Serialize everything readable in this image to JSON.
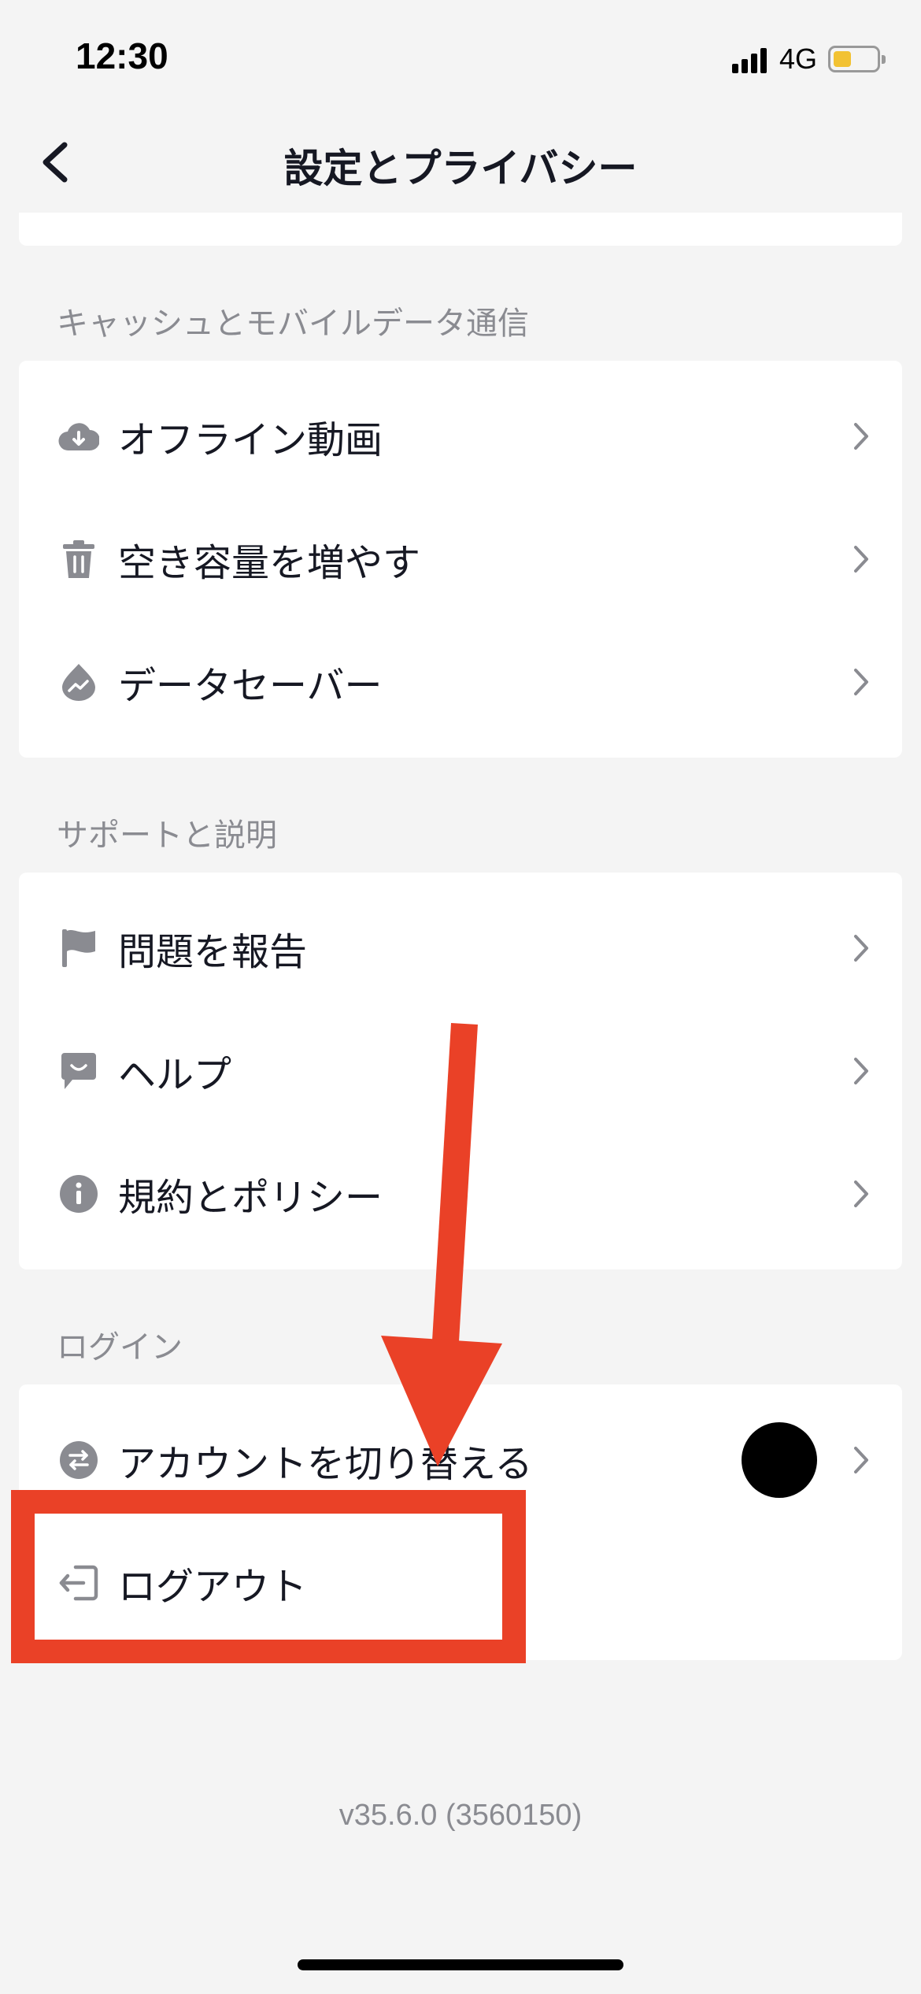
{
  "status_bar": {
    "time": "12:30",
    "network": "4G"
  },
  "nav": {
    "title": "設定とプライバシー",
    "back_icon": "chevron-left-icon"
  },
  "sections": {
    "cache": {
      "header": "キャッシュとモバイルデータ通信",
      "items": [
        {
          "label": "オフライン動画",
          "icon": "cloud-download-icon"
        },
        {
          "label": "空き容量を増やす",
          "icon": "trash-icon"
        },
        {
          "label": "データセーバー",
          "icon": "data-saver-icon"
        }
      ]
    },
    "support": {
      "header": "サポートと説明",
      "items": [
        {
          "label": "問題を報告",
          "icon": "flag-icon"
        },
        {
          "label": "ヘルプ",
          "icon": "chat-bubble-icon"
        },
        {
          "label": "規約とポリシー",
          "icon": "info-icon"
        }
      ]
    },
    "login": {
      "header": "ログイン",
      "items": [
        {
          "label": "アカウントを切り替える",
          "icon": "switch-account-icon"
        },
        {
          "label": "ログアウト",
          "icon": "logout-icon"
        }
      ]
    }
  },
  "version": "v35.6.0 (3560150)",
  "colors": {
    "annotation": "#ea4127",
    "icon_gray": "#8a8b91",
    "chevron": "#8a8b91"
  }
}
